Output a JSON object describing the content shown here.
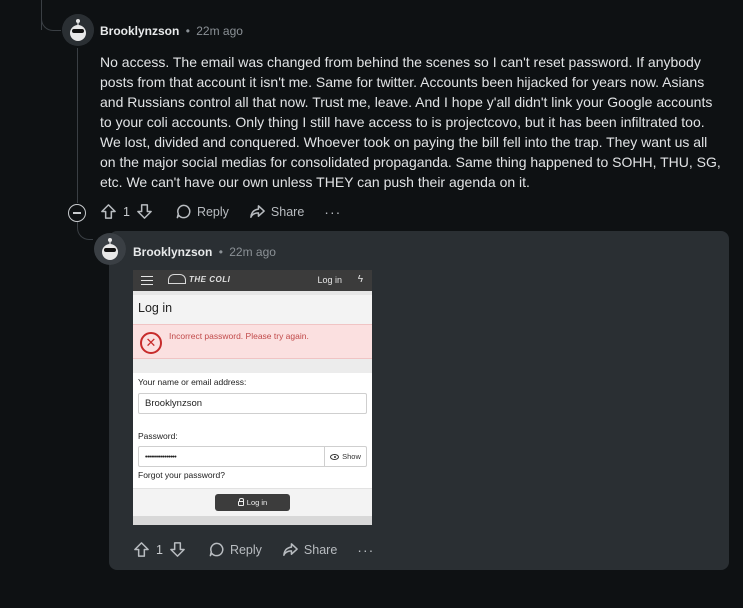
{
  "parent_comment": {
    "author": "Brooklynzson",
    "separator": "•",
    "time": "22m ago",
    "body": "No access. The email was changed from behind the scenes so I can't reset password. If anybody posts from that account it isn't me. Same for twitter. Accounts been hijacked for years now. Asians and Russians control all that now. Trust me, leave. And I hope y'all didn't link your Google accounts to your coli accounts. Only thing I still have access to is projectcovo, but it has been infiltrated too. We lost, divided and conquered. Whoever took on paying the bill fell into the trap. They want us all on the major social medias for consolidated propaganda. Same thing happened to SOHH, THU, SG, etc. We can't have our own unless THEY can push their agenda on it.",
    "votes": "1",
    "reply_label": "Reply",
    "share_label": "Share",
    "more_label": "···"
  },
  "reply_comment": {
    "author": "Brooklynzson",
    "separator": "•",
    "time": "22m ago",
    "votes": "1",
    "reply_label": "Reply",
    "share_label": "Share",
    "more_label": "···",
    "embedded_screenshot": {
      "logo_text": "THE COLI",
      "header_login_link": "Log in",
      "page_title": "Log in",
      "error_message": "Incorrect password. Please try again.",
      "name_label": "Your name or email address:",
      "name_value": "Brooklynzson",
      "password_label": "Password:",
      "password_value": "••••••••••••••••",
      "show_label": "Show",
      "forgot_link": "Forgot your password?",
      "login_button": "Log in"
    }
  },
  "icons": {
    "upvote": "arrow-up-icon",
    "downvote": "arrow-down-icon",
    "reply": "comment-bubble-icon",
    "share": "share-arrow-icon",
    "collapse": "minus-circle-icon"
  },
  "colors": {
    "background": "#0e1113",
    "card": "#2a2f33",
    "error_bg": "#fbe0e0",
    "error_text": "#c14a4a"
  }
}
